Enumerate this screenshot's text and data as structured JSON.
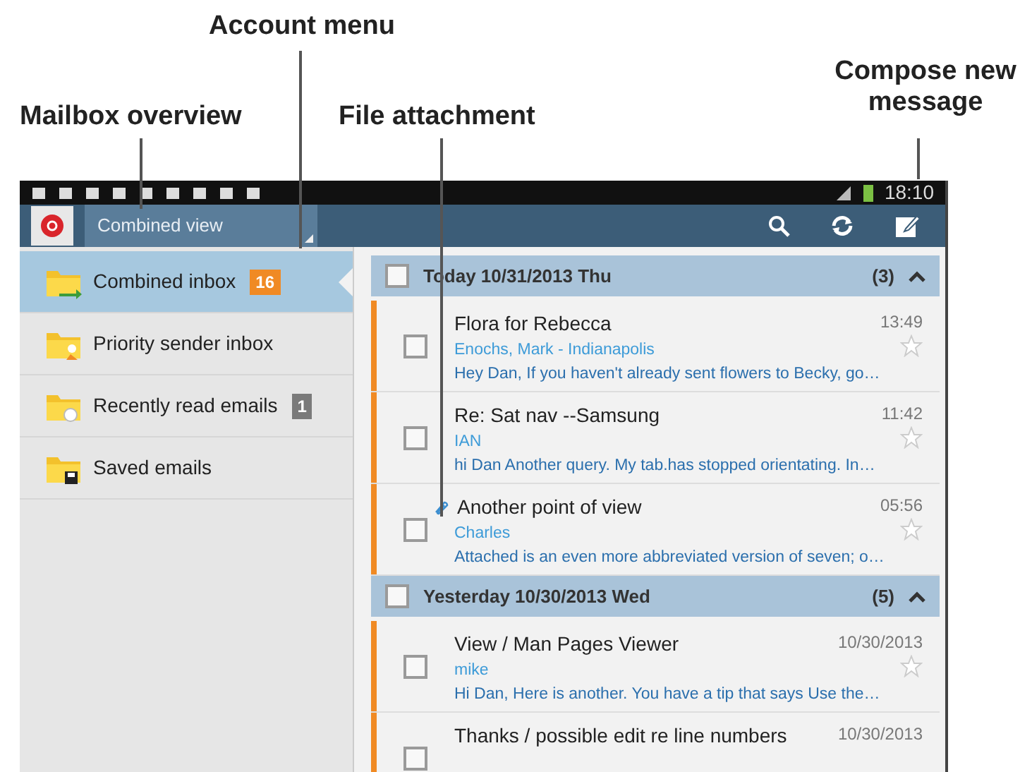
{
  "callouts": [
    {
      "text": "Account menu"
    },
    {
      "text": "Mailbox overview"
    },
    {
      "text": "File attachment"
    },
    {
      "text": "Compose new message"
    }
  ],
  "status_bar": {
    "time": "18:10"
  },
  "action_bar": {
    "account_menu": "Combined view"
  },
  "sidebar": {
    "items": [
      {
        "label": "Combined inbox",
        "badge": "16",
        "color": "#f08a24",
        "selected": true
      },
      {
        "label": "Priority sender inbox",
        "selected": false
      },
      {
        "label": "Recently read emails",
        "badge": "1",
        "color": "#7a7a7a",
        "selected": false
      },
      {
        "label": "Saved emails",
        "selected": false
      }
    ]
  },
  "groups": [
    {
      "title": "Today  10/31/2013 Thu",
      "count": "(3)",
      "checked": false,
      "expanded": true,
      "emails": [
        {
          "subject": "Flora for Rebecca",
          "sender": "Enochs, Mark - Indianapolis",
          "preview": "Hey Dan, If you haven't already sent flowers to Becky, go…",
          "time": "13:49",
          "checked": false,
          "starred": false,
          "attachment": false
        },
        {
          "subject": "Re: Sat nav --Samsung",
          "sender": "IAN",
          "preview": "hi Dan Another query. My tab.has stopped orientating. In…",
          "time": "11:42",
          "checked": false,
          "starred": false,
          "attachment": false
        },
        {
          "subject": "Another point of view",
          "sender": "Charles",
          "preview": "Attached is an even more abbreviated version of seven; o…",
          "time": "05:56",
          "checked": false,
          "starred": false,
          "attachment": true
        }
      ]
    },
    {
      "title": "Yesterday  10/30/2013 Wed",
      "count": "(5)",
      "checked": false,
      "expanded": true,
      "emails": [
        {
          "subject": "View / Man Pages Viewer",
          "sender": "mike",
          "preview": "Hi Dan, Here is another. You have a tip that says Use the…",
          "time": "10/30/2013",
          "checked": false,
          "starred": false,
          "attachment": false
        },
        {
          "subject": "Thanks / possible edit re line numbers",
          "time": "10/30/2013",
          "checked": false,
          "attachment": false
        }
      ]
    }
  ]
}
